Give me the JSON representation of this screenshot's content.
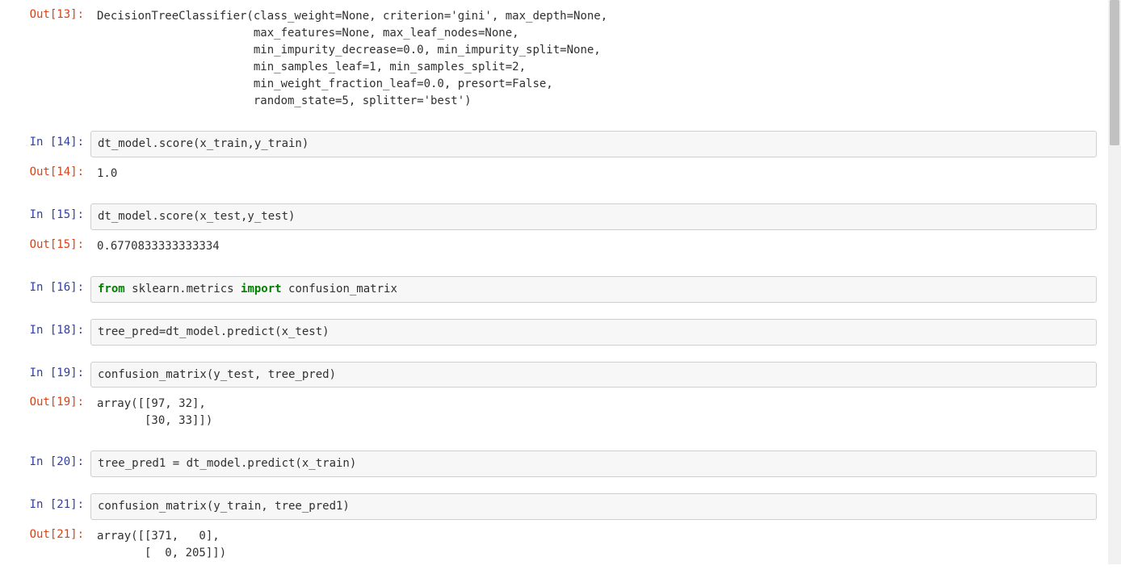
{
  "cells": [
    {
      "out_prompt": "Out[13]:",
      "output": "DecisionTreeClassifier(class_weight=None, criterion='gini', max_depth=None,\n                       max_features=None, max_leaf_nodes=None,\n                       min_impurity_decrease=0.0, min_impurity_split=None,\n                       min_samples_leaf=1, min_samples_split=2,\n                       min_weight_fraction_leaf=0.0, presort=False,\n                       random_state=5, splitter='best')"
    },
    {
      "in_prompt": "In [14]:",
      "input_plain": "dt_model.score(x_train,y_train)",
      "out_prompt": "Out[14]:",
      "output": "1.0"
    },
    {
      "in_prompt": "In [15]:",
      "input_plain": "dt_model.score(x_test,y_test)",
      "out_prompt": "Out[15]:",
      "output": "0.6770833333333334"
    },
    {
      "in_prompt": "In [16]:",
      "import_from": "from",
      "import_module": " sklearn.metrics ",
      "import_kw": "import",
      "import_target": " confusion_matrix"
    },
    {
      "in_prompt": "In [18]:",
      "input_plain": "tree_pred=dt_model.predict(x_test)"
    },
    {
      "in_prompt": "In [19]:",
      "input_plain": "confusion_matrix(y_test, tree_pred)",
      "out_prompt": "Out[19]:",
      "output": "array([[97, 32],\n       [30, 33]])"
    },
    {
      "in_prompt": "In [20]:",
      "input_plain": "tree_pred1 = dt_model.predict(x_train)"
    },
    {
      "in_prompt": "In [21]:",
      "input_plain": "confusion_matrix(y_train, tree_pred1)",
      "out_prompt": "Out[21]:",
      "output": "array([[371,   0],\n       [  0, 205]])"
    }
  ]
}
